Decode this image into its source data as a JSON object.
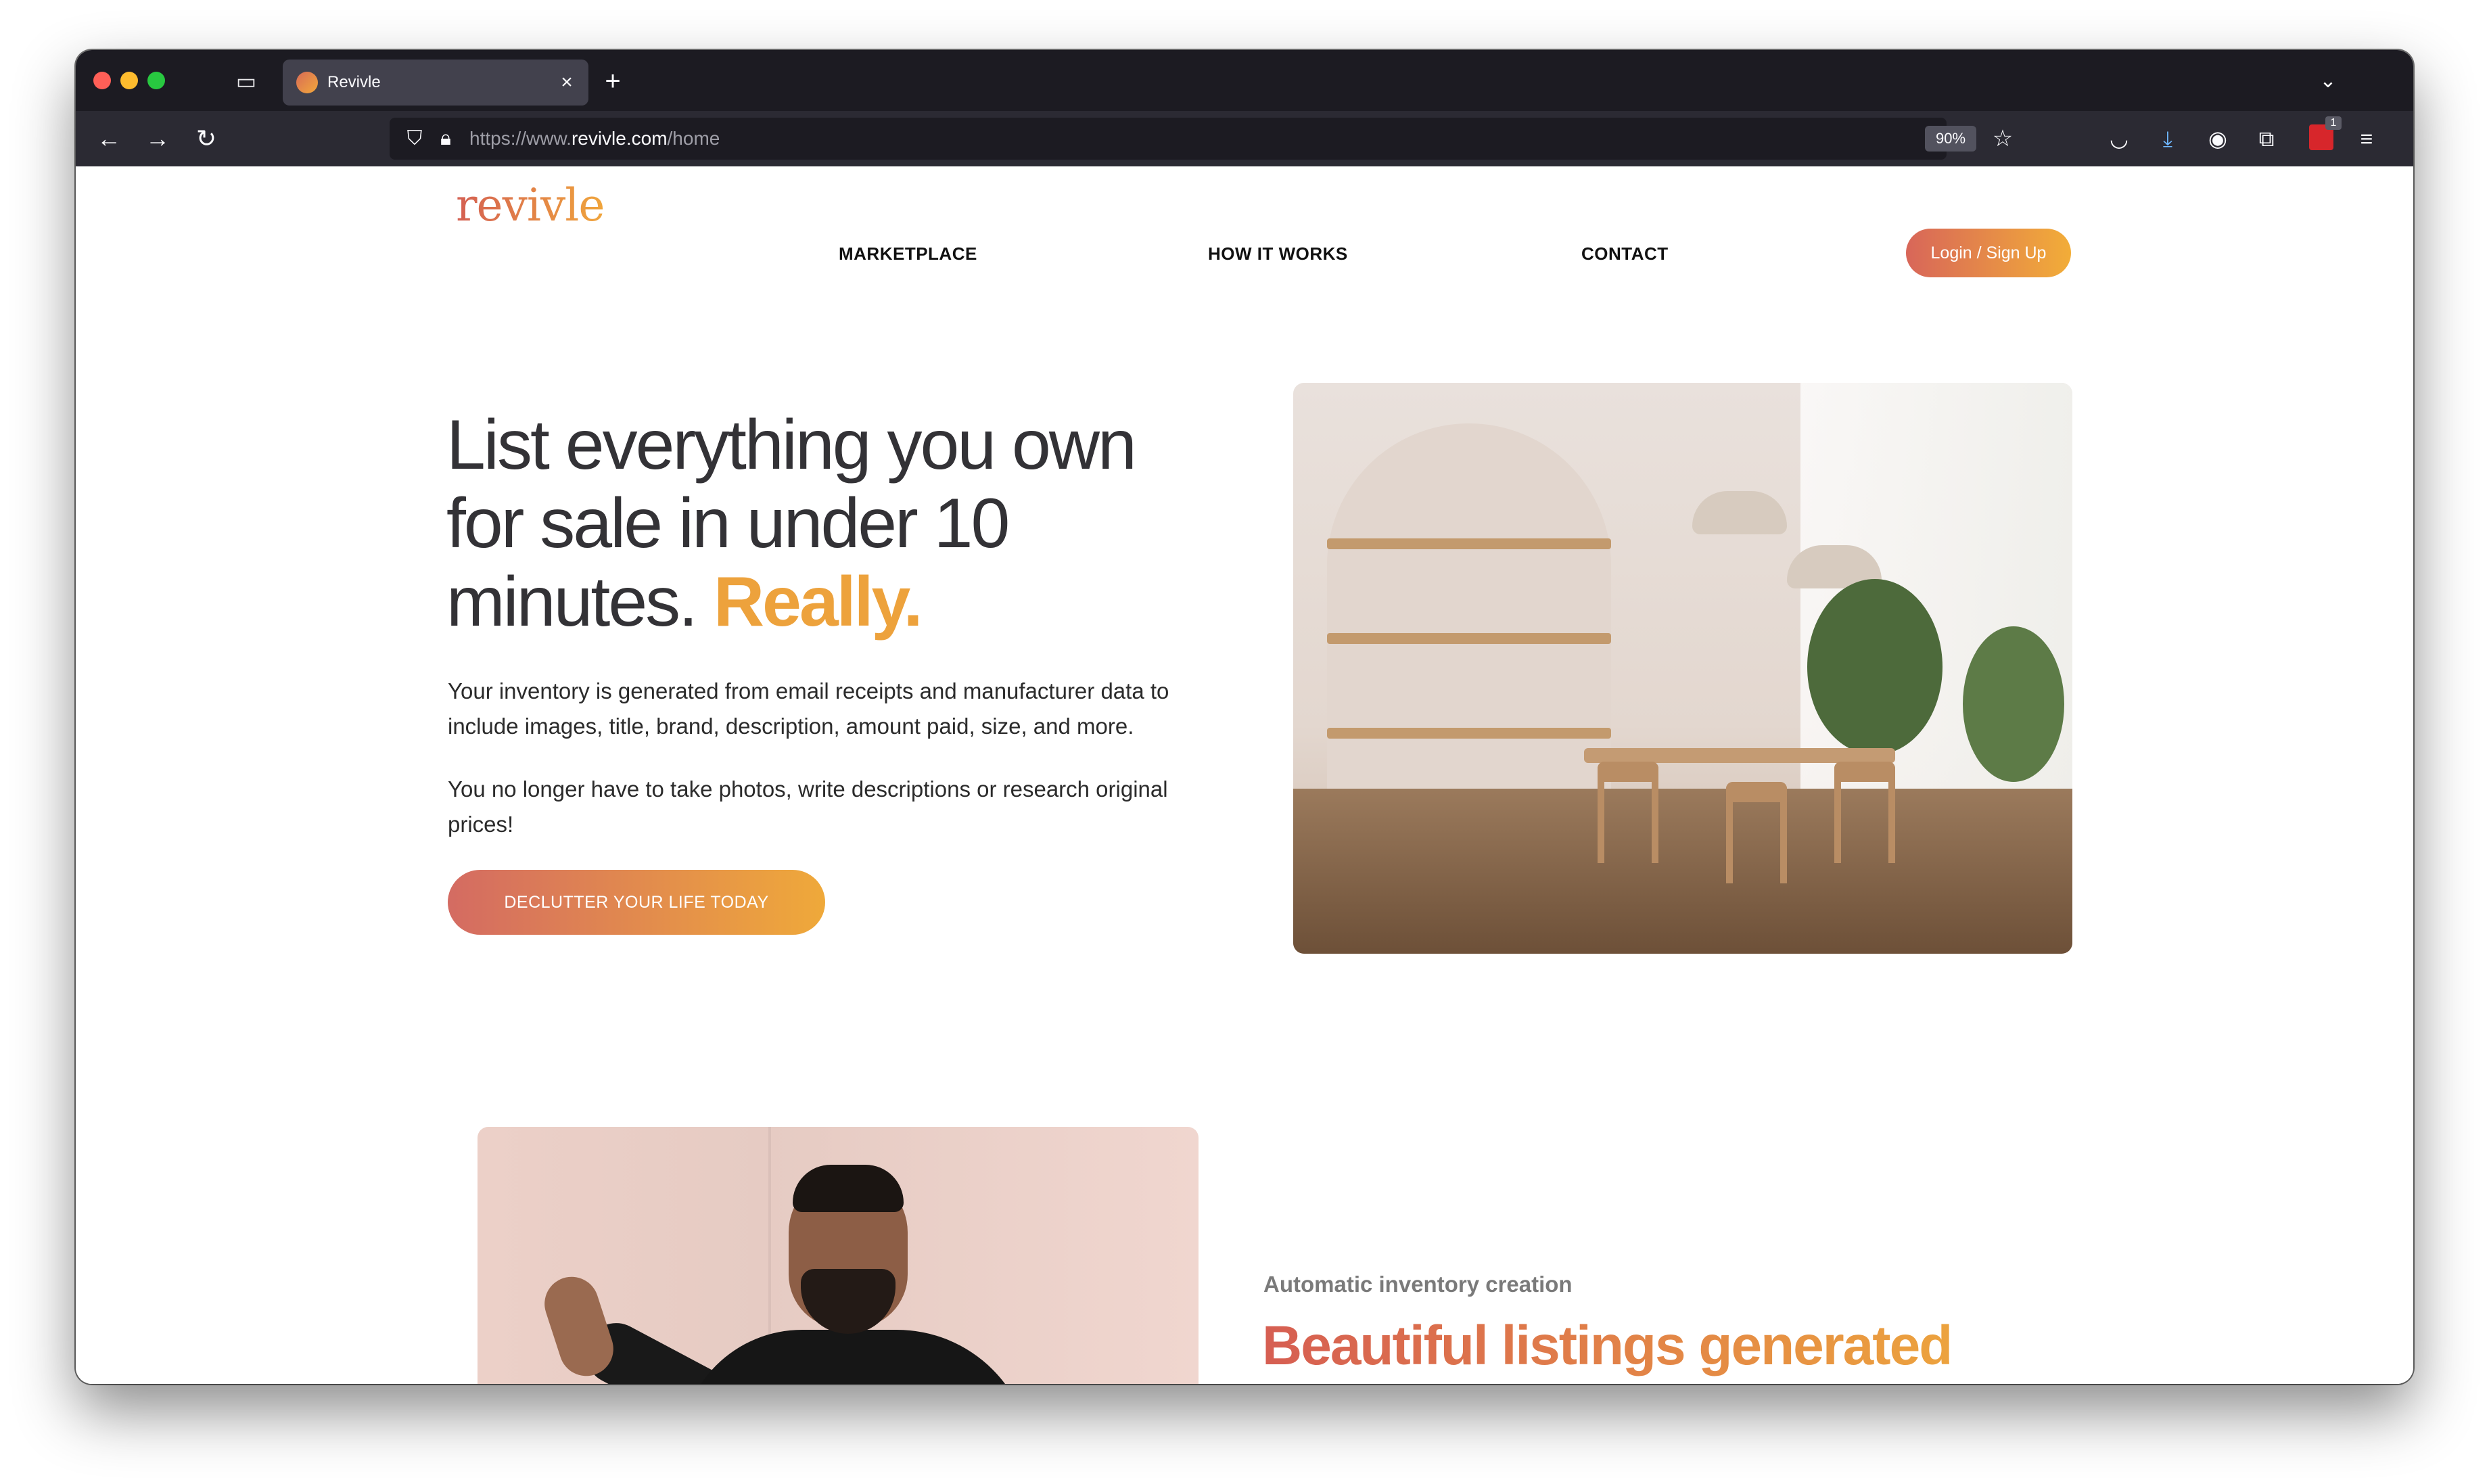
{
  "browser": {
    "tab_title": "Revivle",
    "tab_close": "×",
    "new_tab": "+",
    "url_prefix": "https://www.",
    "url_domain": "revivle.com",
    "url_path": "/home",
    "zoom": "90%",
    "extension_count": "1"
  },
  "site": {
    "logo": "revivle",
    "nav": {
      "marketplace": "MARKETPLACE",
      "how_it_works": "HOW IT WORKS",
      "contact": "CONTACT",
      "login": "Login / Sign Up"
    },
    "hero": {
      "title_main": "List everything you own for sale in under 10 minutes. ",
      "title_accent": "Really.",
      "paragraph_1": "Your inventory is generated from email receipts and manufacturer data to include images, title, brand, description, amount paid, size, and more.",
      "paragraph_2": "You no longer have to take photos, write descriptions or research original prices!",
      "cta": "DECLUTTER YOUR LIFE TODAY"
    },
    "feature": {
      "kicker": "Automatic inventory creation",
      "title": "Beautiful listings generated from your orders"
    }
  },
  "icons": {
    "tab_overview": "tab-overview-icon",
    "back": "arrow-left-icon",
    "forward": "arrow-right-icon",
    "reload": "reload-icon",
    "shield": "shield-icon",
    "lock": "lock-icon",
    "bookmark": "star-icon",
    "pocket": "pocket-icon",
    "downloads": "download-icon",
    "account": "account-icon",
    "extensions": "puzzle-icon",
    "menu": "hamburger-menu-icon"
  },
  "colors": {
    "brand_start": "#d65e52",
    "brand_end": "#eea83c",
    "accent_text": "#eda23c"
  }
}
